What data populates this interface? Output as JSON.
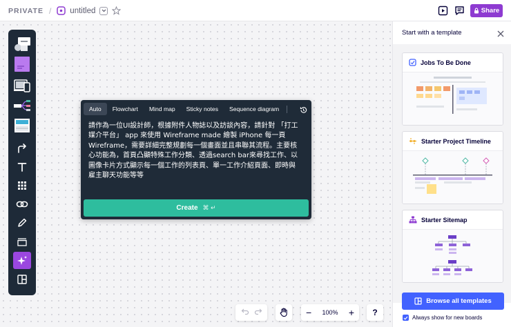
{
  "topbar": {
    "privacy": "PRIVATE",
    "separator": "/",
    "board_title": "untitled",
    "share_label": "Share",
    "icons": [
      "board-icon",
      "chevron-down-icon",
      "star-icon",
      "presentation-icon",
      "comment-icon",
      "lock-icon"
    ],
    "share_color": "#8e3bd1"
  },
  "toolbar": {
    "tools": [
      "templates",
      "sticky-note",
      "device-frames",
      "mind-map",
      "board-frame",
      "connection-line",
      "text",
      "grid",
      "link",
      "pen",
      "frame",
      "magic-ai",
      "layout"
    ]
  },
  "ai_dialog": {
    "tabs": [
      "Auto",
      "Flowchart",
      "Mind map",
      "Sticky notes",
      "Sequence diagram"
    ],
    "active_tab": "Auto",
    "prompt_lines": [
      "請作為一位UI設計師，根據附件人物誌以及訪談內容，請針對 「打工",
      "媒介平台」 app 來使用 Wireframe made 繪製 iPhone 每一頁",
      "Wireframe，需要詳細完整規劃每一個畫面並且串聯其流程。主要核",
      "心功能為，首頁凸顯特殊工作分類、透過search bar來尋找工作、以",
      "圖像卡片方式顯示每一個工作的列表頁、單一工作介紹頁面、即時與",
      "雇主聊天功能等等"
    ],
    "create_label": "Create",
    "create_shortcut": "⌘ ↵",
    "create_color": "#2ebd9e"
  },
  "bottom": {
    "zoom": "100%",
    "zoom_out": "−",
    "zoom_in": "+",
    "help": "?"
  },
  "panel": {
    "title": "Start with a template",
    "templates": [
      {
        "title": "Jobs To Be Done"
      },
      {
        "title": "Starter Project Timeline"
      },
      {
        "title": "Starter Sitemap"
      }
    ],
    "browse_label": "Browse all templates",
    "always_show_label": "Always show for new boards",
    "accent": "#4262ff"
  }
}
